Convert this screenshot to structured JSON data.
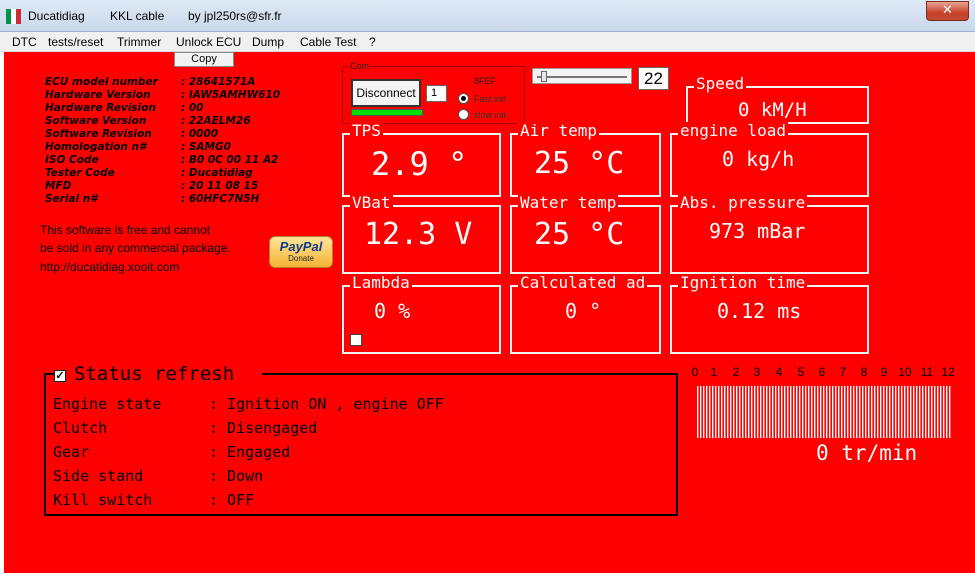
{
  "titlebar": {
    "app_name": "Ducatidiag",
    "cable": "KKL cable",
    "author": "by jpl250rs@sfr.fr",
    "close_label": "✕",
    "flag_colors": [
      "#009246",
      "#ffffff",
      "#ce2b37"
    ]
  },
  "menu": [
    "DTC",
    "tests/reset",
    "Trimmer",
    "Unlock ECU",
    "Dump",
    "Cable Test",
    "?"
  ],
  "copy_label": "Copy",
  "ecu_info": [
    {
      "label": "ECU model number",
      "value": ": 28641571A"
    },
    {
      "label": "Hardware Version",
      "value": ": IAW5AMHW610"
    },
    {
      "label": "Hardware Revision",
      "value": ": 00"
    },
    {
      "label": "Software Version",
      "value": ": 22AELM26"
    },
    {
      "label": "Software Revision",
      "value": ": 0000"
    },
    {
      "label": "Homologation n#",
      "value": ": SAMG0"
    },
    {
      "label": "ISO Code",
      "value": ": B0 0C 00 11 A2"
    },
    {
      "label": "Tester Code",
      "value": ": Ducatidiag"
    },
    {
      "label": "MFD",
      "value": ": 20 11 08 15"
    },
    {
      "label": "Serial n#",
      "value": ": 60HFC7N5H"
    }
  ],
  "free_text": [
    "This software is free and cannot",
    "be sold in any commercial package.",
    "http://ducatidiag.xooit.com"
  ],
  "paypal": {
    "brand": "PayPal",
    "label": "Donate"
  },
  "com": {
    "legend": "Com",
    "disconnect_label": "Disconnect",
    "port": "1",
    "code": "8FEF",
    "fast_init": "Fast init",
    "slow_init": "slow init",
    "selected_init": "fast"
  },
  "slider": {
    "value": "22",
    "level": 0.1
  },
  "gauges": {
    "speed": {
      "title": "Speed",
      "value": "0 kM/H"
    },
    "tps": {
      "title": "TPS",
      "value": "2.9 °"
    },
    "air_temp": {
      "title": "Air temp",
      "value": "25 °C"
    },
    "engine_load": {
      "title": "engine load",
      "value": "0 kg/h"
    },
    "vbat": {
      "title": "VBat",
      "value": "12.3 V"
    },
    "water_temp": {
      "title": "Water temp",
      "value": "25 °C"
    },
    "abs_pressure": {
      "title": "Abs. pressure",
      "value": "973 mBar"
    },
    "lambda": {
      "title": "Lambda",
      "value": "0     %"
    },
    "calculated_ad": {
      "title": "Calculated ad",
      "value": "0 °"
    },
    "ignition_time": {
      "title": "Ignition time",
      "value": "0.12 ms"
    }
  },
  "status": {
    "title": "Status refresh",
    "checked": true,
    "rows": [
      {
        "label": "Engine state",
        "value": ": Ignition ON , engine OFF"
      },
      {
        "label": "Clutch",
        "value": ": Disengaged"
      },
      {
        "label": "Gear",
        "value": ": Engaged"
      },
      {
        "label": "Side stand",
        "value": ": Down"
      },
      {
        "label": "Kill switch",
        "value": ": OFF"
      }
    ]
  },
  "rpm": {
    "ticks": [
      "0",
      "1",
      "2",
      "3",
      "4",
      "5",
      "6",
      "7",
      "8",
      "9",
      "10",
      "11",
      "12"
    ],
    "value": "0 tr/min"
  },
  "colors": {
    "panel": "#ff0000",
    "connected": "#00dd00"
  }
}
